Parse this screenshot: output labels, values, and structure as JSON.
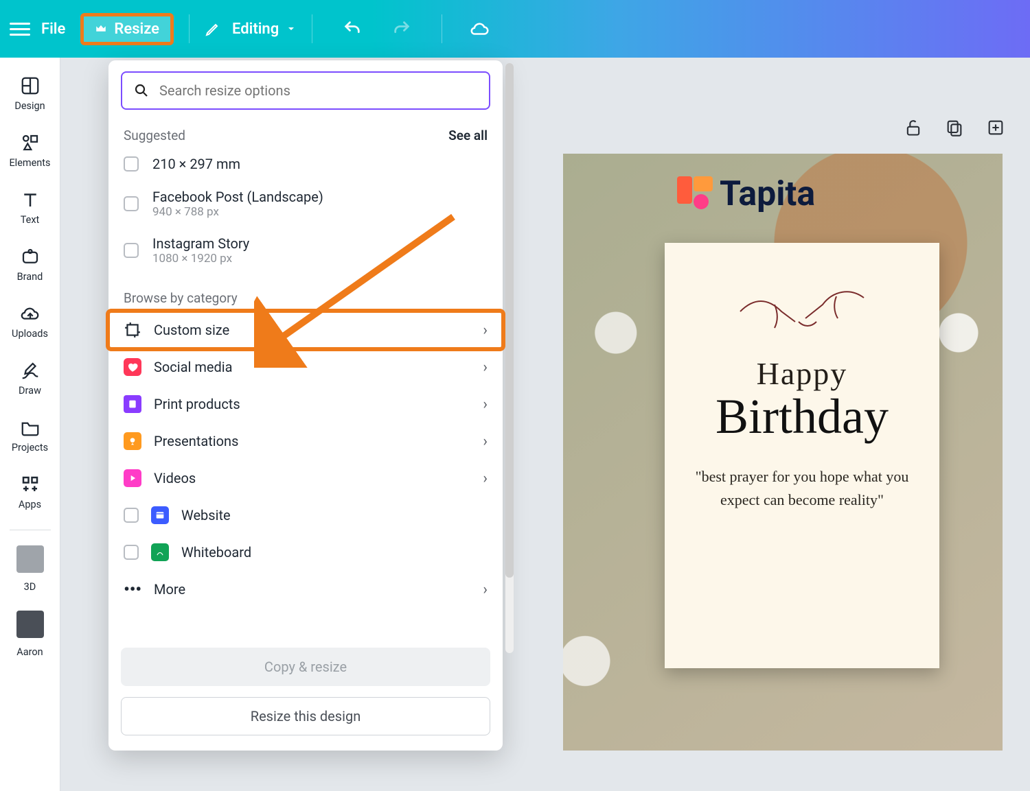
{
  "topbar": {
    "file": "File",
    "resize": "Resize",
    "editing": "Editing"
  },
  "leftrail": {
    "items": [
      {
        "label": "Design"
      },
      {
        "label": "Elements"
      },
      {
        "label": "Text"
      },
      {
        "label": "Brand"
      },
      {
        "label": "Uploads"
      },
      {
        "label": "Draw"
      },
      {
        "label": "Projects"
      },
      {
        "label": "Apps"
      }
    ],
    "extras": [
      {
        "label": "3D"
      },
      {
        "label": "Aaron"
      }
    ]
  },
  "panel": {
    "search_placeholder": "Search resize options",
    "suggested_label": "Suggested",
    "see_all": "See all",
    "suggested": [
      {
        "title": "210 × 297 mm",
        "sub": ""
      },
      {
        "title": "Facebook Post (Landscape)",
        "sub": "940 × 788 px"
      },
      {
        "title": "Instagram Story",
        "sub": "1080 × 1920 px"
      }
    ],
    "browse_label": "Browse by category",
    "categories": [
      {
        "label": "Custom size",
        "icon": "custom",
        "checkbox": false,
        "chev": true
      },
      {
        "label": "Social media",
        "icon": "heart",
        "checkbox": false,
        "chev": true
      },
      {
        "label": "Print products",
        "icon": "print",
        "checkbox": false,
        "chev": true
      },
      {
        "label": "Presentations",
        "icon": "present",
        "checkbox": false,
        "chev": true
      },
      {
        "label": "Videos",
        "icon": "video",
        "checkbox": false,
        "chev": true
      },
      {
        "label": "Website",
        "icon": "web",
        "checkbox": true,
        "chev": false
      },
      {
        "label": "Whiteboard",
        "icon": "board",
        "checkbox": true,
        "chev": false
      },
      {
        "label": "More",
        "icon": "more",
        "checkbox": false,
        "chev": true
      }
    ],
    "copy_resize": "Copy & resize",
    "resize_design": "Resize this design"
  },
  "watermark": {
    "brand": "Tapita"
  },
  "card": {
    "line1": "Happy",
    "line2": "Birthday",
    "quote": "\"best prayer for you hope what you expect can become reality\""
  }
}
